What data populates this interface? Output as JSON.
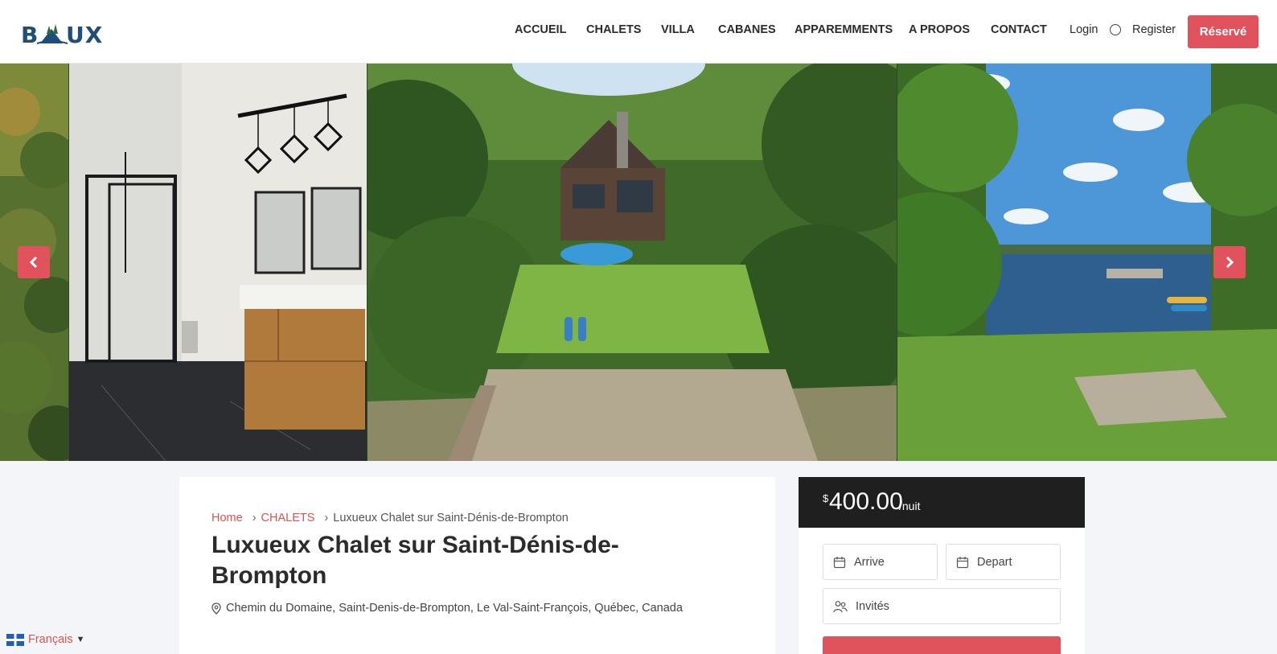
{
  "brand": {
    "logo_text": "BEAUX",
    "accent_color": "#e0525c",
    "logo_color": "#1f4e79"
  },
  "nav": {
    "items": [
      {
        "label": "ACCUEIL"
      },
      {
        "label": "CHALETS"
      },
      {
        "label": "VILLA"
      },
      {
        "label": "CABANES"
      },
      {
        "label": "APPAREMMENTS"
      },
      {
        "label": "A PROPOS"
      },
      {
        "label": "CONTACT"
      }
    ],
    "login": "Login",
    "register": "Register",
    "reserve": "Réservé"
  },
  "gallery": {
    "photos": [
      "forest-edge",
      "bathroom",
      "chalet-lake-aerial",
      "lake-view"
    ],
    "prev_icon": "chevron-left-icon",
    "next_icon": "chevron-right-icon"
  },
  "breadcrumb": {
    "home": "Home",
    "category": "CHALETS",
    "current": "Luxueux Chalet sur Saint-Dénis-de-Brompton"
  },
  "listing": {
    "title": "Luxueux Chalet sur Saint-Dénis-de-Brompton",
    "address": "Chemin du Domaine, Saint-Denis-de-Brompton, Le Val-Saint-François, Québec, Canada"
  },
  "booking": {
    "currency": "$",
    "price": "400.00",
    "unit": "/nuit",
    "arrive_placeholder": "Arrive",
    "depart_placeholder": "Depart",
    "guests_placeholder": "Invités"
  },
  "language": {
    "label": "Français",
    "caret": "▼"
  }
}
